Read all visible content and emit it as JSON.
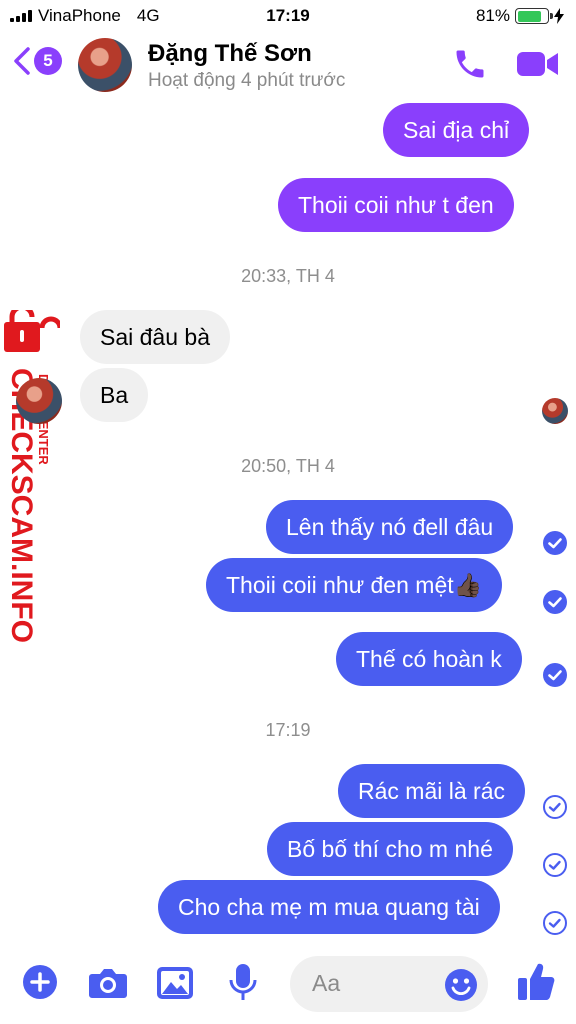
{
  "status_bar": {
    "carrier": "VinaPhone",
    "network": "4G",
    "time": "17:19",
    "battery": "81%",
    "battery_level": 0.81
  },
  "header": {
    "unread_count": "5",
    "contact_name": "Đặng Thế Sơn",
    "presence": "Hoạt động 4 phút trước"
  },
  "watermark": {
    "brand": "CHECKSCAM.INFO",
    "sub": "DATA CENTER"
  },
  "messages": [
    {
      "text": "Sai địa chỉ",
      "from": "me"
    },
    {
      "text": "Thoii coii như t đen",
      "from": "me"
    },
    {
      "text": "20:33, TH 4",
      "type": "timestamp"
    },
    {
      "text": "Sai đâu bà",
      "from": "them"
    },
    {
      "text": "Ba",
      "from": "them"
    },
    {
      "text": "20:50, TH 4",
      "type": "timestamp"
    },
    {
      "text": "Lên thấy nó đell đâu",
      "from": "me",
      "status": "delivered"
    },
    {
      "text": "Thoii coii như đen mệt👍🏿",
      "from": "me",
      "status": "delivered"
    },
    {
      "text": "Thế có hoàn k",
      "from": "me",
      "status": "delivered"
    },
    {
      "text": "17:19",
      "type": "timestamp"
    },
    {
      "text": "Rác mãi là rác",
      "from": "me",
      "status": "sent"
    },
    {
      "text": "Bố bố thí cho m nhé",
      "from": "me",
      "status": "sent"
    },
    {
      "text": "Cho cha mẹ m mua quang tài",
      "from": "me",
      "status": "sent"
    }
  ],
  "composer": {
    "placeholder": "Aa"
  },
  "colors": {
    "accent_purple": "#8a3ffc",
    "accent_blue": "#4a5df0",
    "incoming_bg": "#f0f0f0",
    "watermark_red": "#e0191e"
  }
}
